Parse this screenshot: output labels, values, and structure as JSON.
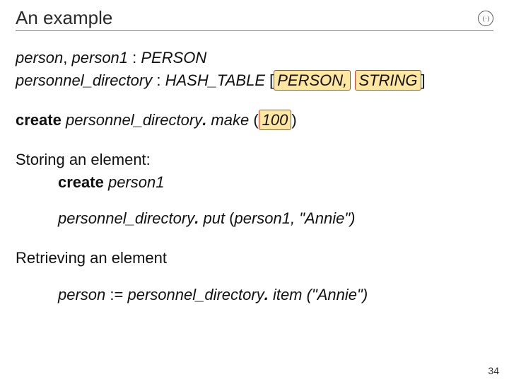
{
  "title": "An example",
  "logo_glyph": "( · )",
  "decl": {
    "line1_a": "person",
    "line1_b": ", ",
    "line1_c": "person1 ",
    "line1_d": ": ",
    "line1_e": "PERSON",
    "line2_a": "personnel_directory ",
    "line2_b": ": ",
    "line2_c": "HASH_TABLE ",
    "line2_d": "[",
    "line2_hl1": "PERSON,",
    "line2_sp": " ",
    "line2_hl2": "STRING ",
    "line2_e": "]"
  },
  "create_line": {
    "kw": "create",
    "mid": " personnel_directory",
    "dot": ".",
    "make": " make ",
    "lp": "(",
    "num": "100",
    "rp": ")"
  },
  "store": {
    "heading": "Storing an element:",
    "l1_kw": "create",
    "l1_rest": " person1",
    "l2_a": "personnel_directory",
    "l2_b": ".",
    "l2_c": " put ",
    "l2_d": "(",
    "l2_e": "person1",
    "l2_f": ", \"Annie\")"
  },
  "retrieve": {
    "heading": "Retrieving an element",
    "l1_a": "person ",
    "l1_b": ":= ",
    "l1_c": "personnel_directory",
    "l1_d": ".",
    "l1_e": " item ",
    "l1_f": "(\"Annie\")"
  },
  "page_number": "34"
}
